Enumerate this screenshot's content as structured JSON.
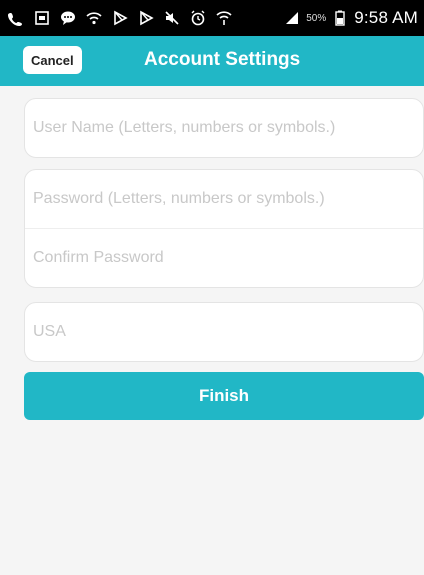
{
  "status_bar": {
    "battery_percent": "50%",
    "time": "9:58 AM",
    "icons": [
      "call-forward-icon",
      "image-icon",
      "chat-icon",
      "wifi-icon",
      "play-store-icon",
      "play-store-icon",
      "mute-icon",
      "alarm-icon",
      "wifi-signal-icon",
      "cell-signal-icon",
      "battery-icon"
    ]
  },
  "app_bar": {
    "cancel_label": "Cancel",
    "title": "Account Settings",
    "color": "#21b7c6"
  },
  "form": {
    "username_placeholder": "User Name (Letters, numbers or symbols.)",
    "username_value": "",
    "password_placeholder": "Password (Letters, numbers or symbols.)",
    "password_value": "",
    "confirm_password_placeholder": "Confirm Password",
    "confirm_password_value": "",
    "country_placeholder": "USA",
    "country_value": ""
  },
  "finish_label": "Finish"
}
